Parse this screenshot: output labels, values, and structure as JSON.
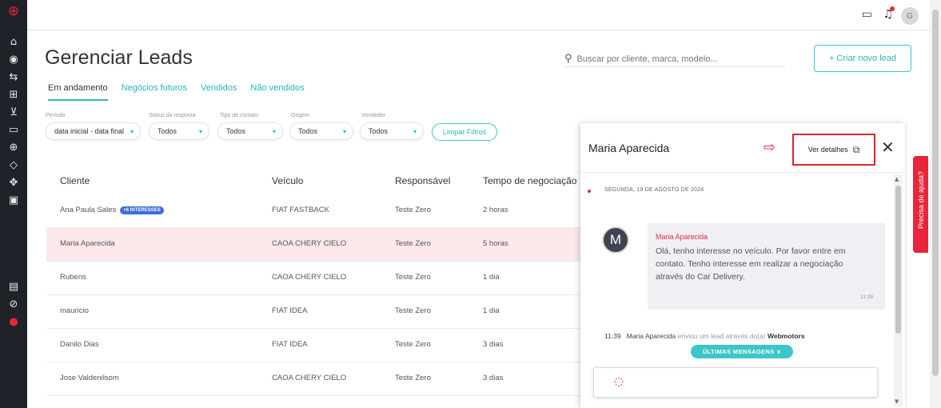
{
  "sidebar": {
    "icons": [
      "logo-icon",
      "home-icon",
      "dashboard-icon",
      "exchange-icon",
      "car-add-icon",
      "cart-icon",
      "wallet-icon",
      "add-circle-icon",
      "tag-icon",
      "settings-icon",
      "calculator-icon",
      "id-card-icon",
      "help-icon",
      "avatar-icon"
    ]
  },
  "page": {
    "title": "Gerenciar Leads",
    "search_placeholder": "Buscar por cliente, marca, modelo...",
    "create_label": "+ Criar novo lead"
  },
  "tabs": [
    "Em andamento",
    "Negócios futuros",
    "Vendidos",
    "Não vendidos"
  ],
  "filters": {
    "periodo": {
      "label": "Período",
      "value": "data inicial - data final"
    },
    "status": {
      "label": "Status da resposta",
      "value": "Todos"
    },
    "tipo": {
      "label": "Tipo de contato",
      "value": "Todos"
    },
    "origem": {
      "label": "Origem",
      "value": "Todos"
    },
    "vendedor": {
      "label": "Vendedor",
      "value": "Todos"
    },
    "clear_label": "Limpar Filtros"
  },
  "table": {
    "headers": [
      "Cliente",
      "Veículo",
      "Responsável",
      "Tempo de negociação"
    ],
    "rows": [
      {
        "cliente": "Ana Paula Sales",
        "badge": "+6 INTERESSES",
        "veiculo": "FIAT FASTBACK",
        "responsavel": "Teste Zero",
        "tempo": "2 horas"
      },
      {
        "cliente": "Maria Aparecida",
        "badge": "",
        "veiculo": "CAOA CHERY CIELO",
        "responsavel": "Teste Zero",
        "tempo": "5 horas"
      },
      {
        "cliente": "Rubens",
        "badge": "",
        "veiculo": "CAOA CHERY CIELO",
        "responsavel": "Teste Zero",
        "tempo": "1 dia"
      },
      {
        "cliente": "mauricio",
        "badge": "",
        "veiculo": "FIAT IDEA",
        "responsavel": "Teste Zero",
        "tempo": "1 dia"
      },
      {
        "cliente": "Danilo Dias",
        "badge": "",
        "veiculo": "FIAT IDEA",
        "responsavel": "Teste Zero",
        "tempo": "3 dias"
      },
      {
        "cliente": "Jose Valdenilsom",
        "badge": "",
        "veiculo": "CAOA CHERY CIELO",
        "responsavel": "Teste Zero",
        "tempo": "3 dias"
      }
    ]
  },
  "panel": {
    "title": "Maria Aparecida",
    "ver_detalhes": "Ver detalhes",
    "date": "SEGUNDA, 19 DE AGOSTO DE 2024",
    "avatar_letter": "M",
    "message": {
      "author": "Maria Aparecida",
      "text": "Olá, tenho interesse no veículo. Por favor entre em contato. Tenho interesse em realizar a negociação através do Car Delivery.",
      "time": "11:39"
    },
    "activity": {
      "time": "11:39",
      "name": "Maria Aparecida",
      "text": "enviou um lead através do(a)",
      "source": "Webmotors"
    },
    "ultimas_label": "ÚLTIMAS MENSAGENS ∨"
  },
  "topbar": {
    "avatar_letter": "G"
  },
  "help_label": "Precisa de ajuda?",
  "colors": {
    "accent": "#2db9bc",
    "brand": "#e8253a",
    "selected_row": "#fde8ea",
    "sidebar": "#1f2228"
  }
}
